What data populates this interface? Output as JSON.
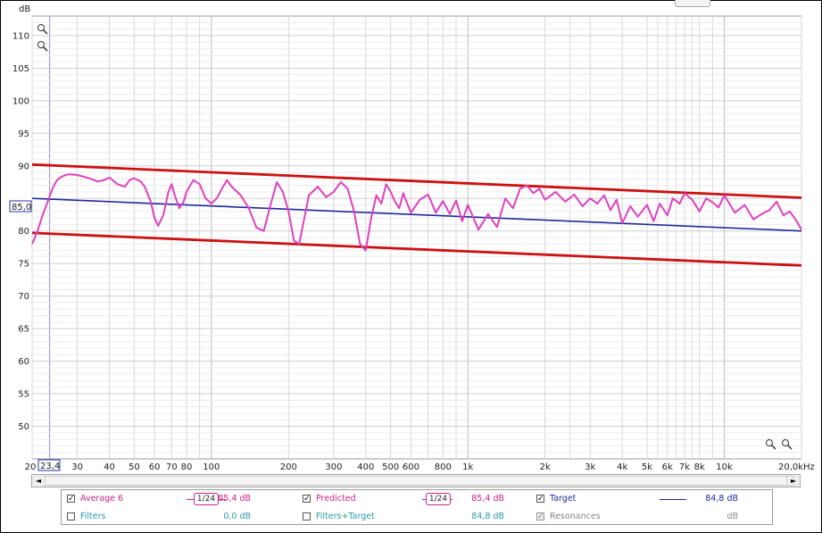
{
  "axes": {
    "y_unit": "dB",
    "y_ticks": [
      "110",
      "105",
      "100",
      "95",
      "90",
      "85",
      "80",
      "75",
      "70",
      "65",
      "60",
      "55",
      "50"
    ],
    "x_unit": "Hz",
    "x_ticks": [
      "20",
      "30",
      "40",
      "50",
      "60",
      "70",
      "80",
      "100",
      "200",
      "300",
      "400",
      "500",
      "600",
      "800",
      "1k",
      "2k",
      "3k",
      "4k",
      "5k",
      "6k",
      "7k",
      "8k",
      "10k",
      "20,0k"
    ],
    "cursor_x_label": "23,4",
    "cursor_y_label": "85,0"
  },
  "chart_data": {
    "type": "line",
    "x_scale": "log",
    "xlim": [
      20,
      20000
    ],
    "ylim": [
      45,
      113
    ],
    "xlabel": "Hz",
    "ylabel": "dB",
    "grid": true,
    "series": [
      {
        "name": "Target",
        "color": "#1e2a9a",
        "x": [
          20,
          20000
        ],
        "y": [
          85.0,
          80.0
        ]
      },
      {
        "color": "#cc1111",
        "x": [
          20,
          20000
        ],
        "y": [
          90.2,
          85.1
        ]
      },
      {
        "color": "#cc1111",
        "x": [
          20,
          20000
        ],
        "y": [
          79.7,
          74.7
        ]
      },
      {
        "name": "Predicted",
        "color": "#e040c0",
        "x": [
          20,
          21,
          22,
          23,
          24,
          25,
          26,
          27,
          28,
          30,
          32,
          34,
          36,
          38,
          40,
          43,
          46,
          48,
          50,
          53,
          55,
          58,
          60,
          62,
          65,
          68,
          70,
          72,
          75,
          78,
          80,
          85,
          90,
          95,
          100,
          105,
          110,
          115,
          120,
          130,
          140,
          150,
          160,
          170,
          180,
          190,
          200,
          210,
          220,
          240,
          260,
          280,
          300,
          320,
          340,
          360,
          380,
          400,
          420,
          440,
          460,
          480,
          500,
          520,
          540,
          560,
          600,
          650,
          700,
          750,
          800,
          850,
          900,
          950,
          1000,
          1100,
          1200,
          1300,
          1400,
          1500,
          1600,
          1700,
          1800,
          1900,
          2000,
          2200,
          2400,
          2600,
          2800,
          3000,
          3200,
          3400,
          3600,
          3800,
          4000,
          4300,
          4600,
          5000,
          5300,
          5600,
          6000,
          6300,
          6700,
          7000,
          7500,
          8000,
          8500,
          9000,
          9500,
          10000,
          11000,
          12000,
          13000,
          14000,
          15000,
          16000,
          17000,
          18000,
          19000,
          20000
        ],
        "y": [
          78.0,
          80.0,
          82.5,
          84.5,
          86.5,
          87.8,
          88.3,
          88.6,
          88.7,
          88.6,
          88.3,
          88.0,
          87.6,
          87.8,
          88.2,
          87.2,
          86.8,
          87.8,
          88.1,
          87.6,
          86.8,
          84.5,
          82.0,
          80.8,
          82.5,
          86.0,
          87.2,
          85.5,
          83.5,
          84.5,
          86.0,
          87.8,
          87.2,
          85.0,
          84.2,
          85.0,
          86.5,
          87.8,
          86.8,
          85.5,
          83.5,
          80.5,
          80.0,
          84.0,
          87.5,
          86.0,
          83.0,
          78.5,
          78.0,
          85.5,
          86.8,
          85.2,
          86.0,
          87.5,
          86.5,
          83.0,
          78.0,
          77.0,
          82.0,
          85.5,
          84.2,
          87.2,
          86.0,
          84.5,
          83.5,
          85.8,
          82.8,
          84.8,
          85.6,
          82.8,
          84.6,
          82.6,
          84.7,
          81.5,
          84.0,
          80.2,
          82.6,
          80.6,
          85.0,
          83.5,
          86.5,
          87.0,
          85.8,
          86.5,
          84.8,
          86.0,
          84.5,
          85.6,
          83.8,
          85.0,
          84.2,
          85.5,
          83.2,
          84.8,
          81.2,
          83.8,
          82.2,
          84.0,
          81.5,
          84.2,
          82.4,
          85.0,
          84.2,
          85.8,
          84.8,
          83.0,
          85.0,
          84.4,
          83.6,
          85.5,
          82.8,
          84.0,
          81.8,
          82.6,
          83.2,
          84.5,
          82.4,
          83.0,
          81.7,
          80.2
        ]
      }
    ]
  },
  "legend": {
    "average": {
      "label": "Average 6",
      "checked": "✓",
      "smoothing": "1/24",
      "value": "85,4 dB"
    },
    "filters": {
      "label": "Filters",
      "checked": "",
      "value": "0,0 dB"
    },
    "predicted": {
      "label": "Predicted",
      "checked": "✓",
      "smoothing": "1/24",
      "value": "85,4 dB"
    },
    "filters_target": {
      "label": "Filters+Target",
      "checked": "",
      "value": "84,8 dB"
    },
    "target": {
      "label": "Target",
      "checked": "✓",
      "value": "84,8 dB"
    },
    "resonances": {
      "label": "Resonances",
      "checked": "✓",
      "value": "dB"
    }
  },
  "colors": {
    "average": "#cc2288",
    "filters": "#2a9aaa",
    "predicted": "#cc2288",
    "filters_target": "#2a9aaa",
    "target": "#1e2a9a",
    "resonances": "#888888"
  },
  "scrollbar": {
    "left_icon": "◄",
    "right_icon": "►"
  },
  "icons": [
    "zoom-in-icon",
    "zoom-out-icon"
  ]
}
